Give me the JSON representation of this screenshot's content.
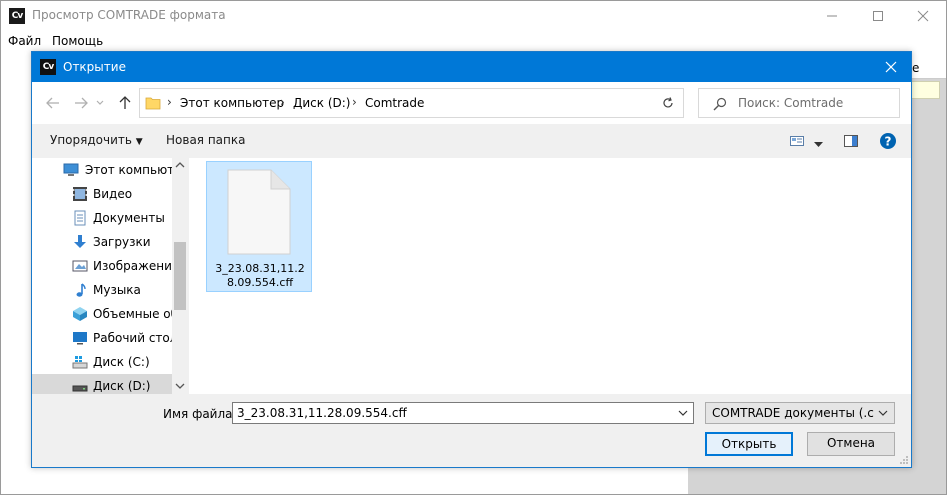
{
  "main_window": {
    "title": "Просмотр COMTRADE формата",
    "app_icon_text": "Cv",
    "menu": [
      "Файл",
      "Помощь"
    ],
    "table_header_fragment": "е"
  },
  "dialog": {
    "title": "Открытие",
    "app_icon_text": "Cv",
    "breadcrumb": [
      "Этот компьютер",
      "Диск (D:)",
      "Comtrade"
    ],
    "search_placeholder": "Поиск: Comtrade",
    "toolbar": {
      "organize_label": "Упорядочить",
      "new_folder_label": "Новая папка"
    },
    "nav_items": [
      {
        "label": "Этот компьютер",
        "icon": "computer-icon",
        "selected": false
      },
      {
        "label": "Видео",
        "icon": "video-icon",
        "selected": false
      },
      {
        "label": "Документы",
        "icon": "documents-icon",
        "selected": false
      },
      {
        "label": "Загрузки",
        "icon": "downloads-icon",
        "selected": false
      },
      {
        "label": "Изображения",
        "icon": "pictures-icon",
        "selected": false
      },
      {
        "label": "Музыка",
        "icon": "music-icon",
        "selected": false
      },
      {
        "label": "Объемные объекты",
        "icon": "3d-objects-icon",
        "selected": false
      },
      {
        "label": "Рабочий стол",
        "icon": "desktop-icon",
        "selected": false
      },
      {
        "label": "Диск (C:)",
        "icon": "drive-c-icon",
        "selected": false
      },
      {
        "label": "Диск (D:)",
        "icon": "drive-d-icon",
        "selected": true
      }
    ],
    "files": [
      {
        "name": "3_23.08.31,11.28.09.554.cff",
        "icon": "file-icon",
        "selected": true
      }
    ],
    "file_name_label": "Имя файла:",
    "file_name_value": "3_23.08.31,11.28.09.554.cff",
    "file_type_filter": "COMTRADE документы (.cff,cf",
    "open_label": "Открыть",
    "cancel_label": "Отмена"
  },
  "colors": {
    "accent": "#0078d7",
    "selection": "#cce8ff",
    "selection_border": "#99d1ff",
    "help": "#0063b1"
  }
}
